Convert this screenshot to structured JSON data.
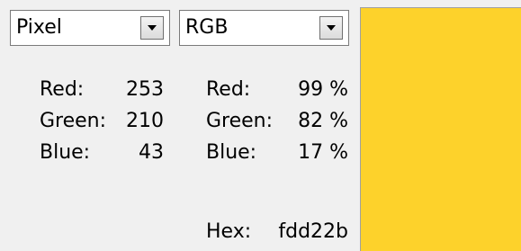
{
  "mode_select": {
    "value": "Pixel"
  },
  "format_select": {
    "value": "RGB"
  },
  "pixel_values": {
    "red_label": "Red:",
    "red_value": "253",
    "green_label": "Green:",
    "green_value": "210",
    "blue_label": "Blue:",
    "blue_value": "43"
  },
  "rgb_values": {
    "red_label": "Red:",
    "red_value": "99 %",
    "green_label": "Green:",
    "green_value": "82 %",
    "blue_label": "Blue:",
    "blue_value": "17 %"
  },
  "hex": {
    "label": "Hex:",
    "value": "fdd22b"
  },
  "swatch": {
    "color": "#fdd22b"
  },
  "icons": {
    "dropdown": "chevron-down-icon"
  }
}
